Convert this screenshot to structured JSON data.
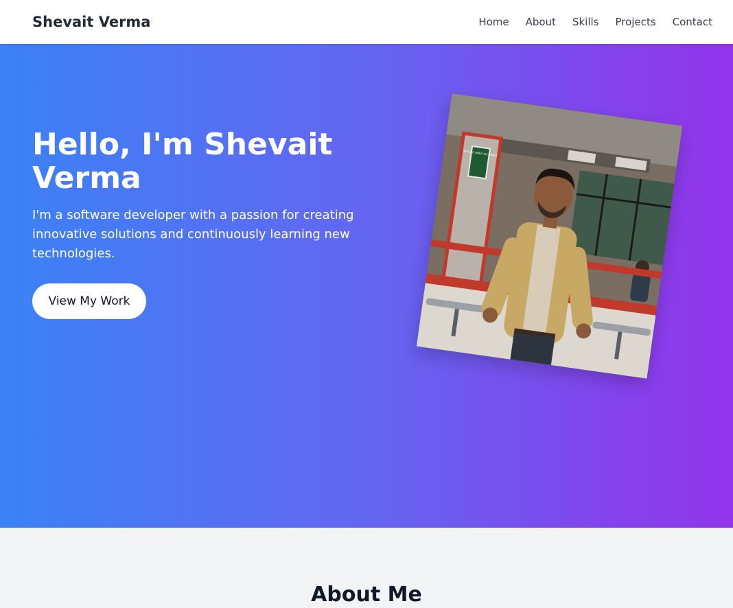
{
  "nav": {
    "brand": "Shevait Verma",
    "links": [
      "Home",
      "About",
      "Skills",
      "Projects",
      "Contact"
    ]
  },
  "hero": {
    "title": "Hello, I'm Shevait Verma",
    "subtitle": "I'm a software developer with a passion for creating innovative solutions and continuously learning new technologies.",
    "cta_label": "View My Work",
    "photo_sign_text": "SITTING AREA ALLOWED"
  },
  "about": {
    "title": "About Me"
  },
  "colors": {
    "gradient_start": "#3b82f6",
    "gradient_end": "#9333ea",
    "nav_bg": "#ffffff",
    "section_bg": "#f3f4f6"
  }
}
